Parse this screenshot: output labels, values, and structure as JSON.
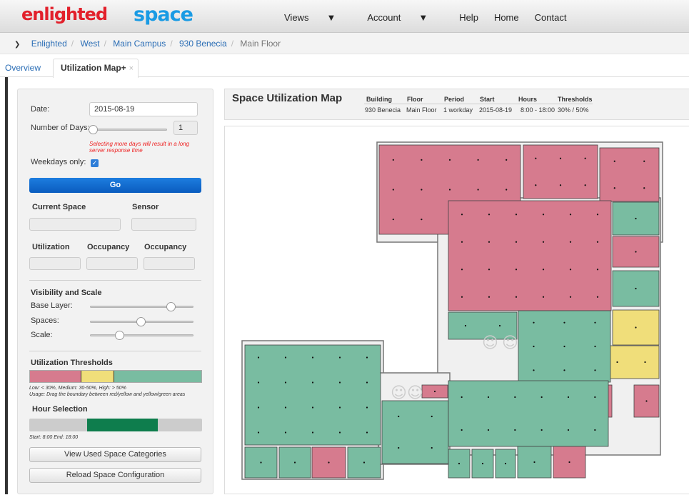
{
  "brand": {
    "logo_left": "enlighted",
    "logo_right": "space"
  },
  "nav": {
    "items": [
      "Views",
      "Account",
      "Help",
      "Home",
      "Contact"
    ]
  },
  "breadcrumb": {
    "items": [
      "Enlighted",
      "West",
      "Main Campus",
      "930 Benecia"
    ],
    "current": "Main Floor"
  },
  "tabs": {
    "overview": "Overview",
    "active": "Utilization Map+",
    "close": "×"
  },
  "controls": {
    "date_label": "Date:",
    "date_value": "2015-08-19",
    "days_label": "Number of Days:",
    "days_value": "1",
    "days_warning": "Selecting more days will result in a long server response time",
    "weekdays_label": "Weekdays only:",
    "weekdays_checked": true,
    "go_label": "Go",
    "current_space_label": "Current Space",
    "sensor_label": "Sensor",
    "utilization_label": "Utilization",
    "occupancy_label_1": "Occupancy",
    "occupancy_label_2": "Occupancy",
    "visibility_title": "Visibility and Scale",
    "base_layer_label": "Base Layer:",
    "spaces_label": "Spaces:",
    "scale_label": "Scale:",
    "base_layer_level": 0.78,
    "spaces_level": 0.49,
    "scale_level": 0.28,
    "thresholds_title": "Utilization Thresholds",
    "thresholds_low": 0.3,
    "thresholds_high": 0.5,
    "thresholds_note_1": "Low: < 30%, Medium: 30-50%, High: > 50%",
    "thresholds_note_2": "Usage: Drag the boundary between red/yellow and yellow/green areas",
    "hour_title": "Hour Selection",
    "hour_note": "Start: 8:00 End: 18:00",
    "view_button": "View Used Space Categories",
    "reload_button": "Reload Space Configuration"
  },
  "map_header": {
    "title": "Space Utilization Map",
    "columns": [
      {
        "h": "Building",
        "v": "930 Benecia"
      },
      {
        "h": "Floor",
        "v": "Main Floor"
      },
      {
        "h": "Period",
        "v": "1 workday"
      },
      {
        "h": "Start",
        "v": "2015-08-19"
      },
      {
        "h": "Hours",
        "v": "8:00 - 18:00"
      },
      {
        "h": "Thresholds",
        "v": "30% / 50%"
      }
    ]
  },
  "colors": {
    "high": "#d67b8e",
    "medium": "#f0de7a",
    "low": "#79bca1",
    "neutral": "#f0f0f0",
    "hour_selected": "#0e7d4d",
    "accent": "#2a6db5",
    "brand_red": "#e2202b",
    "brand_blue": "#1a9be4"
  },
  "map_rooms_status": [
    "high",
    "high",
    "high",
    "high",
    "low",
    "high",
    "low",
    "medium",
    "medium",
    "high",
    "high",
    "low",
    "low",
    "low",
    "low",
    "low",
    "low",
    "low",
    "high",
    "low",
    "low",
    "low",
    "low",
    "high"
  ]
}
